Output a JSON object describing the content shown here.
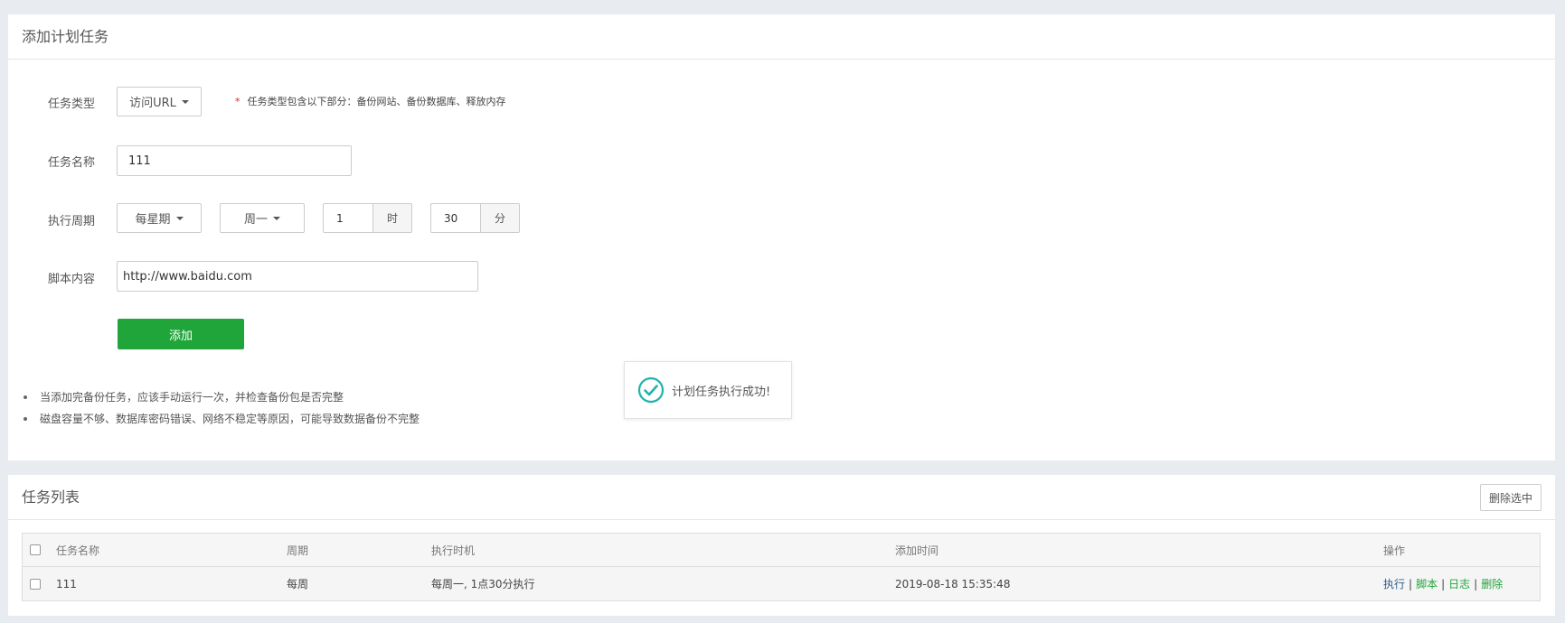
{
  "add_panel": {
    "title": "添加计划任务",
    "task_type_label": "任务类型",
    "task_type_value": "访问URL",
    "task_type_hint_star": "*",
    "task_type_hint": "任务类型包含以下部分：备份网站、备份数据库、释放内存",
    "task_name_label": "任务名称",
    "task_name_value": "111",
    "cycle_label": "执行周期",
    "cycle_value": "每星期",
    "weekday_value": "周一",
    "hour_value": "1",
    "hour_unit": "时",
    "minute_value": "30",
    "minute_unit": "分",
    "script_label": "脚本内容",
    "script_value": "http://www.baidu.com",
    "add_button": "添加",
    "notes": [
      "当添加完备份任务，应该手动运行一次，并检查备份包是否完整",
      "磁盘容量不够、数据库密码错误、网络不稳定等原因，可能导致数据备份不完整"
    ]
  },
  "toast": {
    "message": "计划任务执行成功!"
  },
  "list_panel": {
    "title": "任务列表",
    "delete_selected": "删除选中",
    "columns": {
      "name": "任务名称",
      "cycle": "周期",
      "exec_time": "执行时机",
      "add_time": "添加时间",
      "ops": "操作"
    },
    "rows": [
      {
        "name": "111",
        "cycle": "每周",
        "exec_time": "每周一, 1点30分执行",
        "add_time": "2019-08-18 15:35:48",
        "op_exec": "执行",
        "op_script": "脚本",
        "op_log": "日志",
        "op_delete": "删除",
        "separator": "|"
      }
    ]
  },
  "colors": {
    "primary_green": "#20a53a",
    "link_blue": "#2b5f8c",
    "toast_check": "#20b2aa"
  }
}
